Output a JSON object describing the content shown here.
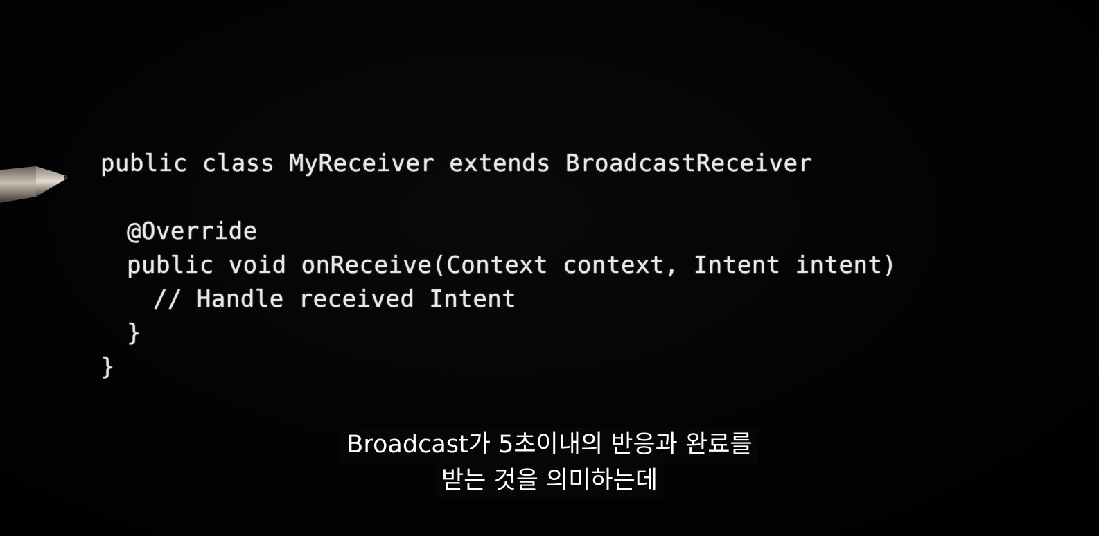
{
  "video": {
    "code_lines": [
      {
        "text": "public class MyReceiver extends BroadcastReceiver",
        "indent": 0
      },
      {
        "text": "",
        "indent": 0
      },
      {
        "text": "@Override",
        "indent": 1
      },
      {
        "text": "public void onReceive(Context context, Intent intent)",
        "indent": 1
      },
      {
        "text": "// Handle received Intent",
        "indent": 2
      },
      {
        "text": "}",
        "indent": 1
      },
      {
        "text": "}",
        "indent": 0
      }
    ],
    "subtitle": {
      "line1": "Broadcast가 5초이내의 반응과 완료를",
      "line2": "받는 것을 의미하는데"
    },
    "pen_icon": "pen-icon",
    "colors": {
      "background": "#000000",
      "chalk_text": "#e9e9e9",
      "subtitle_text": "#ffffff",
      "subtitle_bg": "#080808"
    }
  }
}
